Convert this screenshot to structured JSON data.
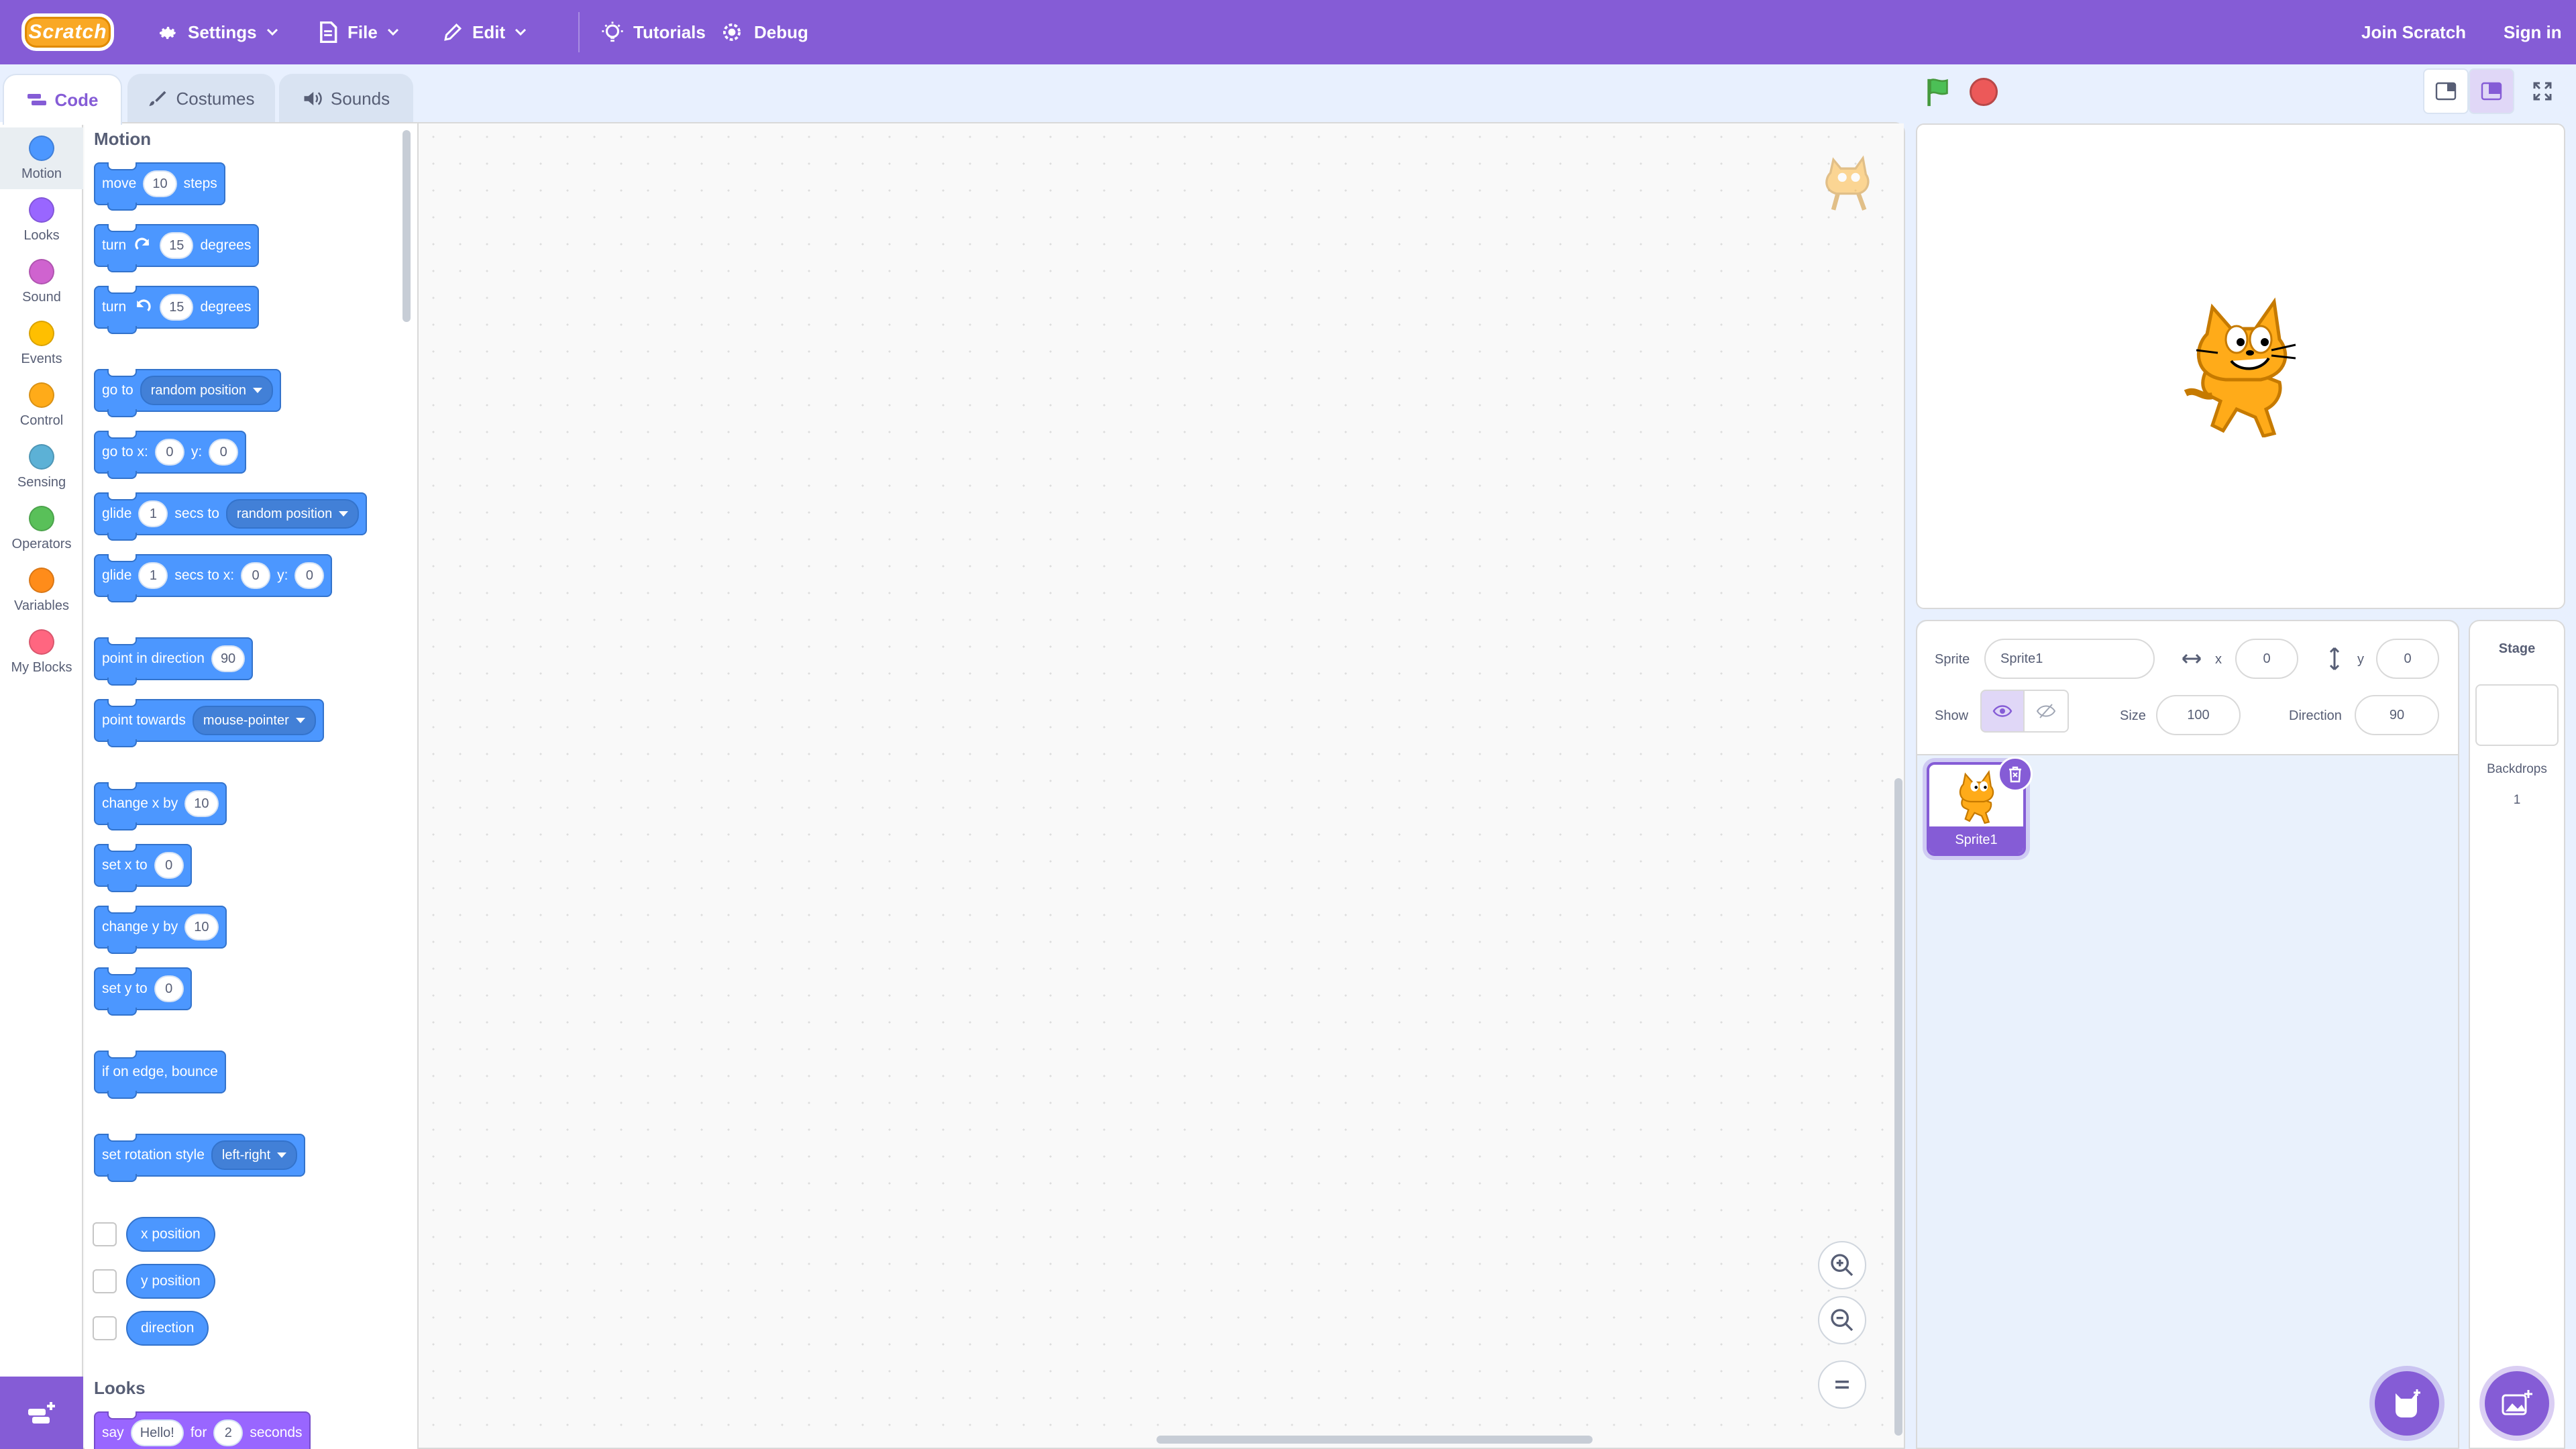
{
  "colors": {
    "menu_bg": "#855cd6",
    "motion": "#4c97ff",
    "looks": "#9966ff",
    "accent": "#855cd6"
  },
  "menu": {
    "logo_text": "Scratch",
    "settings": "Settings",
    "file": "File",
    "edit": "Edit",
    "tutorials": "Tutorials",
    "debug": "Debug",
    "join": "Join Scratch",
    "signin": "Sign in"
  },
  "tabs": {
    "code": "Code",
    "costumes": "Costumes",
    "sounds": "Sounds"
  },
  "categories": [
    {
      "label": "Motion",
      "color": "#4c97ff"
    },
    {
      "label": "Looks",
      "color": "#9966ff"
    },
    {
      "label": "Sound",
      "color": "#cf63cf"
    },
    {
      "label": "Events",
      "color": "#ffbf00"
    },
    {
      "label": "Control",
      "color": "#ffab19"
    },
    {
      "label": "Sensing",
      "color": "#5cb1d6"
    },
    {
      "label": "Operators",
      "color": "#59c059"
    },
    {
      "label": "Variables",
      "color": "#ff8c1a"
    },
    {
      "label": "My Blocks",
      "color": "#ff6680"
    }
  ],
  "palette": {
    "motion_title": "Motion",
    "looks_title": "Looks",
    "move": {
      "a": "move",
      "v": "10",
      "b": "steps"
    },
    "turn_right": {
      "a": "turn",
      "v": "15",
      "b": "degrees"
    },
    "turn_left": {
      "a": "turn",
      "v": "15",
      "b": "degrees"
    },
    "goto": {
      "a": "go to",
      "d": "random position"
    },
    "gotoxy": {
      "a": "go to x:",
      "x": "0",
      "y_label": "y:",
      "y": "0"
    },
    "glide_to": {
      "a": "glide",
      "v": "1",
      "b": "secs to",
      "d": "random position"
    },
    "glide_xy": {
      "a": "glide",
      "v": "1",
      "b": "secs to x:",
      "x": "0",
      "y_label": "y:",
      "y": "0"
    },
    "point_dir": {
      "a": "point in direction",
      "v": "90"
    },
    "point_towards": {
      "a": "point towards",
      "d": "mouse-pointer"
    },
    "change_x": {
      "a": "change x by",
      "v": "10"
    },
    "set_x": {
      "a": "set x to",
      "v": "0"
    },
    "change_y": {
      "a": "change y by",
      "v": "10"
    },
    "set_y": {
      "a": "set y to",
      "v": "0"
    },
    "bounce": "if on edge, bounce",
    "rotation": {
      "a": "set rotation style",
      "d": "left-right"
    },
    "reporters": [
      "x position",
      "y position",
      "direction"
    ],
    "say": {
      "a": "say",
      "msg": "Hello!",
      "b": "for",
      "v": "2",
      "c": "seconds"
    }
  },
  "sprite_info": {
    "sprite_label": "Sprite",
    "sprite_name": "Sprite1",
    "x_label": "x",
    "x": "0",
    "y_label": "y",
    "y": "0",
    "show_label": "Show",
    "size_label": "Size",
    "size": "100",
    "direction_label": "Direction",
    "direction": "90"
  },
  "sprites": [
    {
      "name": "Sprite1"
    }
  ],
  "stage_pane": {
    "title": "Stage",
    "backdrops_label": "Backdrops",
    "backdrops_count": "1"
  }
}
